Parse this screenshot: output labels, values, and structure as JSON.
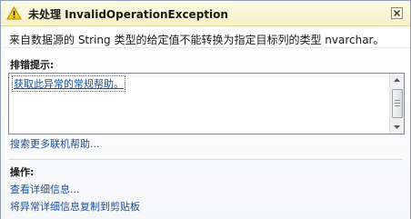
{
  "title_bar": {
    "icon": "warning-icon",
    "title": "未处理 InvalidOperationException",
    "close_icon": "close-icon"
  },
  "message": "来自数据源的 String 类型的给定值不能转换为指定目标列的类型 nvarchar。",
  "troubleshooting": {
    "heading": "排错提示:",
    "tips": [
      "获取此异常的常规帮助。"
    ]
  },
  "online_help_link": "搜索更多联机帮助...",
  "actions": {
    "heading": "操作:",
    "items": [
      "查看详细信息...",
      "将异常详细信息复制到剪贴板"
    ]
  },
  "colors": {
    "title_bar_bg": "#f7f1c6",
    "link": "#1a4f9c",
    "warning": "#f2c300"
  }
}
